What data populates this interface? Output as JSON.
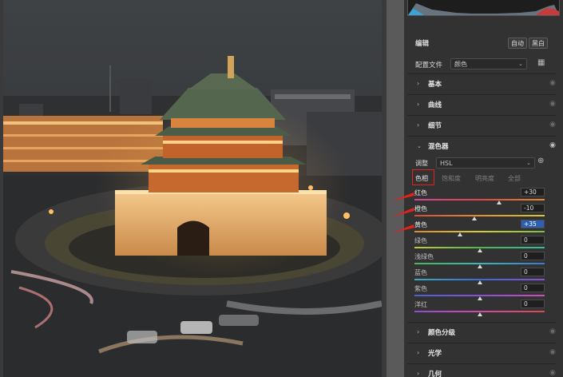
{
  "panel": {
    "section_title": "编辑",
    "auto_button": "自动",
    "bw_button": "黑白",
    "profile_label": "配置文件",
    "profile_value": "颜色",
    "adjust_label": "调整",
    "adjust_value": "HSL"
  },
  "sections_top": [
    {
      "label": "基本"
    },
    {
      "label": "曲线"
    },
    {
      "label": "细节"
    }
  ],
  "mixer": {
    "label": "混色器"
  },
  "tabs": [
    {
      "label": "色相",
      "active": true
    },
    {
      "label": "饱和度",
      "active": false
    },
    {
      "label": "明亮度",
      "active": false
    },
    {
      "label": "全部",
      "active": false
    }
  ],
  "sliders": [
    {
      "label": "红色",
      "value": "+30",
      "position": 0.65,
      "label_color": "#e8e8e8",
      "gradient": [
        "#d0479a",
        "#e04545",
        "#e28a2e"
      ]
    },
    {
      "label": "橙色",
      "value": "-10",
      "position": 0.46,
      "label_color": "#e8e8e8",
      "gradient": [
        "#d84a3c",
        "#e2902e",
        "#d9c83a"
      ]
    },
    {
      "label": "黄色",
      "value": "+35",
      "position": 0.35,
      "label_color": "#e8e8e8",
      "gradient": [
        "#e08a2e",
        "#d8cf3a",
        "#7cc040"
      ]
    },
    {
      "label": "绿色",
      "value": "0",
      "position": 0.5,
      "label_color": "#bdbdbd",
      "gradient": [
        "#c9c93a",
        "#4fb84c",
        "#3ab8a4"
      ]
    },
    {
      "label": "浅绿色",
      "value": "0",
      "position": 0.5,
      "label_color": "#bdbdbd",
      "gradient": [
        "#49b85a",
        "#3ab8b8",
        "#3f7ad8"
      ]
    },
    {
      "label": "蓝色",
      "value": "0",
      "position": 0.5,
      "label_color": "#bdbdbd",
      "gradient": [
        "#36b0c0",
        "#3b6ad8",
        "#8a4fd6"
      ]
    },
    {
      "label": "紫色",
      "value": "0",
      "position": 0.5,
      "label_color": "#bdbdbd",
      "gradient": [
        "#4a62d6",
        "#8b4fd6",
        "#cf4fb8"
      ]
    },
    {
      "label": "洋红",
      "value": "0",
      "position": 0.5,
      "label_color": "#bdbdbd",
      "gradient": [
        "#8b4fd6",
        "#d24aa8",
        "#d84a52"
      ]
    }
  ],
  "sections_bottom": [
    {
      "label": "颜色分级"
    },
    {
      "label": "光学"
    },
    {
      "label": "几何"
    }
  ],
  "colors": {
    "annotation_red": "#e0231c",
    "selection_blue": "#2e5fb3"
  }
}
